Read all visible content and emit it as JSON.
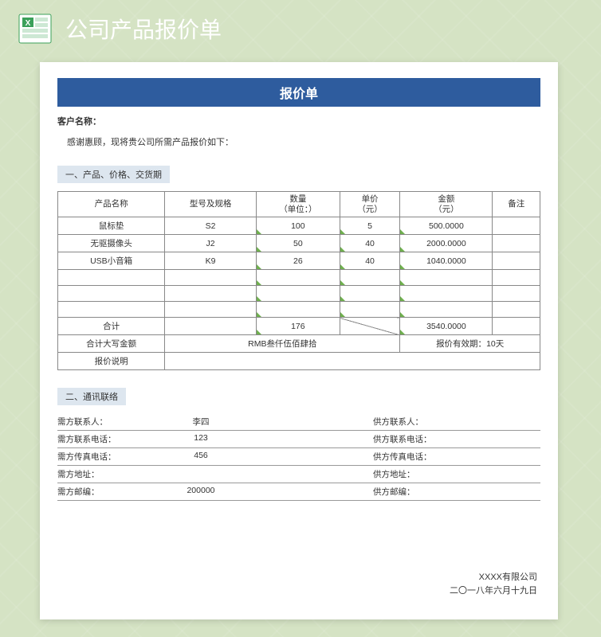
{
  "page": {
    "title": "公司产品报价单"
  },
  "doc": {
    "title": "报价单",
    "customerLabel": "客户名称：",
    "intro": "感谢惠顾，现将贵公司所需产品报价如下：",
    "section1": "一、产品、价格、交货期",
    "section2": "二、通讯联络",
    "headers": {
      "name": "产品名称",
      "spec": "型号及规格",
      "qty": "数量",
      "qtyUnit": "（单位：）",
      "price": "单价",
      "priceUnit": "（元）",
      "amount": "金额",
      "amountUnit": "（元）",
      "remark": "备注"
    },
    "rows": [
      {
        "name": "鼠标垫",
        "spec": "S2",
        "qty": "100",
        "price": "5",
        "amount": "500.0000",
        "remark": ""
      },
      {
        "name": "无驱摄像头",
        "spec": "J2",
        "qty": "50",
        "price": "40",
        "amount": "2000.0000",
        "remark": ""
      },
      {
        "name": "USB小音箱",
        "spec": "K9",
        "qty": "26",
        "price": "40",
        "amount": "1040.0000",
        "remark": ""
      }
    ],
    "totalLabel": "合计",
    "totalQty": "176",
    "totalAmount": "3540.0000",
    "amountWordsLabel": "合计大写金额",
    "amountWords": "RMB叁仟伍佰肆拾",
    "validityLabel": "报价有效期：",
    "validity": "10天",
    "notesLabel": "报价说明",
    "contacts": {
      "l1": {
        "label": "需方联系人：",
        "value": "李四"
      },
      "l2": {
        "label": "需方联系电话：",
        "value": "123"
      },
      "l3": {
        "label": "需方传真电话：",
        "value": "456"
      },
      "l4": {
        "label": "需方地址：",
        "value": ""
      },
      "l5": {
        "label": "需方邮编：",
        "value": "200000"
      },
      "r1": {
        "label": "供方联系人：",
        "value": ""
      },
      "r2": {
        "label": "供方联系电话：",
        "value": ""
      },
      "r3": {
        "label": "供方传真电话：",
        "value": ""
      },
      "r4": {
        "label": "供方地址：",
        "value": ""
      },
      "r5": {
        "label": "供方邮编：",
        "value": ""
      }
    },
    "company": "XXXX有限公司",
    "date": "二〇一八年六月十九日"
  }
}
